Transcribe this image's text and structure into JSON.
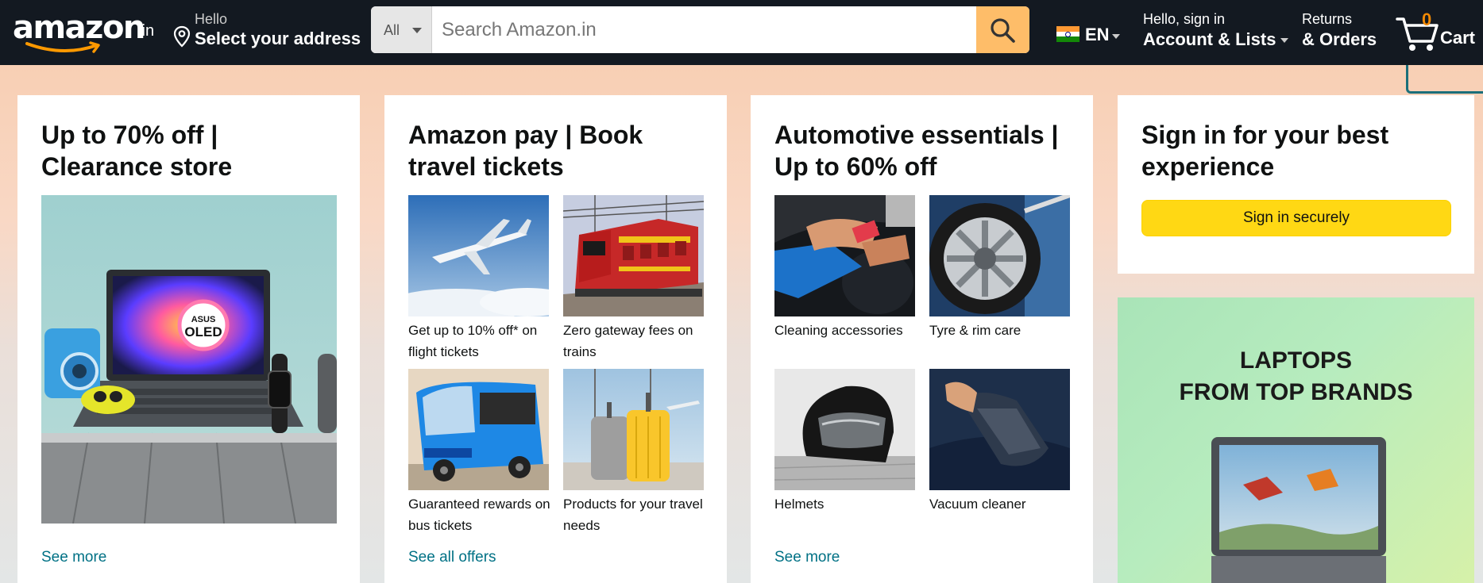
{
  "header": {
    "logo_text": "amazon",
    "logo_tld": ".in",
    "address_hello": "Hello",
    "address_select": "Select your address",
    "search_category": "All",
    "search_placeholder": "Search Amazon.in",
    "language": "EN",
    "account_line1": "Hello, sign in",
    "account_line2": "Account & Lists",
    "orders_line1": "Returns",
    "orders_line2": "& Orders",
    "cart_count": "0",
    "cart_label": "Cart"
  },
  "cards": {
    "clearance": {
      "title": "Up to 70% off | Clearance store",
      "image_badge_brand": "ASUS",
      "image_badge_text": "OLED",
      "link": "See more"
    },
    "amazon_pay": {
      "title": "Amazon pay | Book travel tickets",
      "tiles": [
        {
          "caption": "Get up to 10% off* on flight tickets"
        },
        {
          "caption": "Zero gateway fees on trains"
        },
        {
          "caption": "Guaranteed rewards on bus tickets"
        },
        {
          "caption": "Products for your travel needs"
        }
      ],
      "link": "See all offers"
    },
    "automotive": {
      "title": "Automotive essentials | Up to 60% off",
      "tiles": [
        {
          "caption": "Cleaning accessories"
        },
        {
          "caption": "Tyre & rim care"
        },
        {
          "caption": "Helmets"
        },
        {
          "caption": "Vacuum cleaner"
        }
      ],
      "link": "See more"
    },
    "signin": {
      "title": "Sign in for your best experience",
      "button": "Sign in securely"
    },
    "ad": {
      "line1": "LAPTOPS",
      "line2": "FROM TOP BRANDS"
    }
  },
  "colors": {
    "nav_bg": "#131921",
    "search_button": "#febd69",
    "signin_button": "#ffd814",
    "link": "#007185",
    "cart_count": "#f08804"
  }
}
